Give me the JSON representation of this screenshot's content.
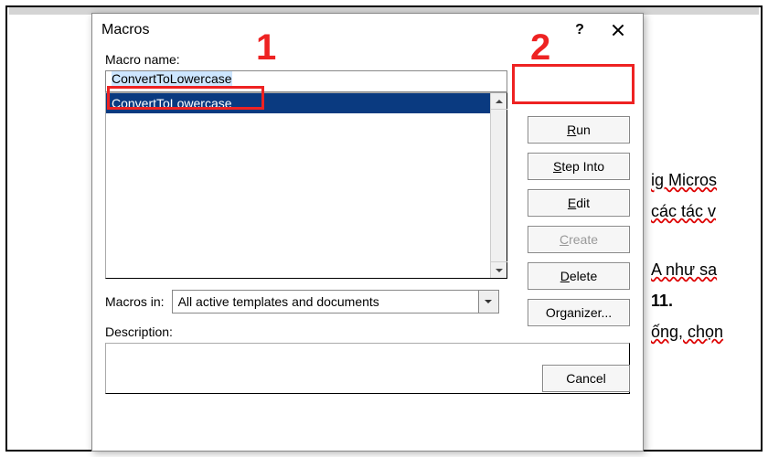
{
  "dialog": {
    "title": "Macros",
    "labels": {
      "macro_name": "Macro name:",
      "macros_in": "Macros in:",
      "description": "Description:"
    },
    "macro_name_value": "ConvertToLowercase",
    "list_items": [
      "ConvertToLowercase"
    ],
    "macros_in_value": "All active templates and documents",
    "description_value": "",
    "buttons": {
      "run": "Run",
      "step_into": "Step Into",
      "edit": "Edit",
      "create": "Create",
      "delete": "Delete",
      "organizer": "Organizer...",
      "cancel": "Cancel"
    },
    "titlebar": {
      "help": "?",
      "close": "×"
    }
  },
  "callouts": {
    "one": "1",
    "two": "2"
  },
  "background_text": {
    "l1": "ig Micros",
    "l2": "các tác v",
    "l3": "A như sa",
    "l4": "11.",
    "l5": "ống, chọn"
  }
}
